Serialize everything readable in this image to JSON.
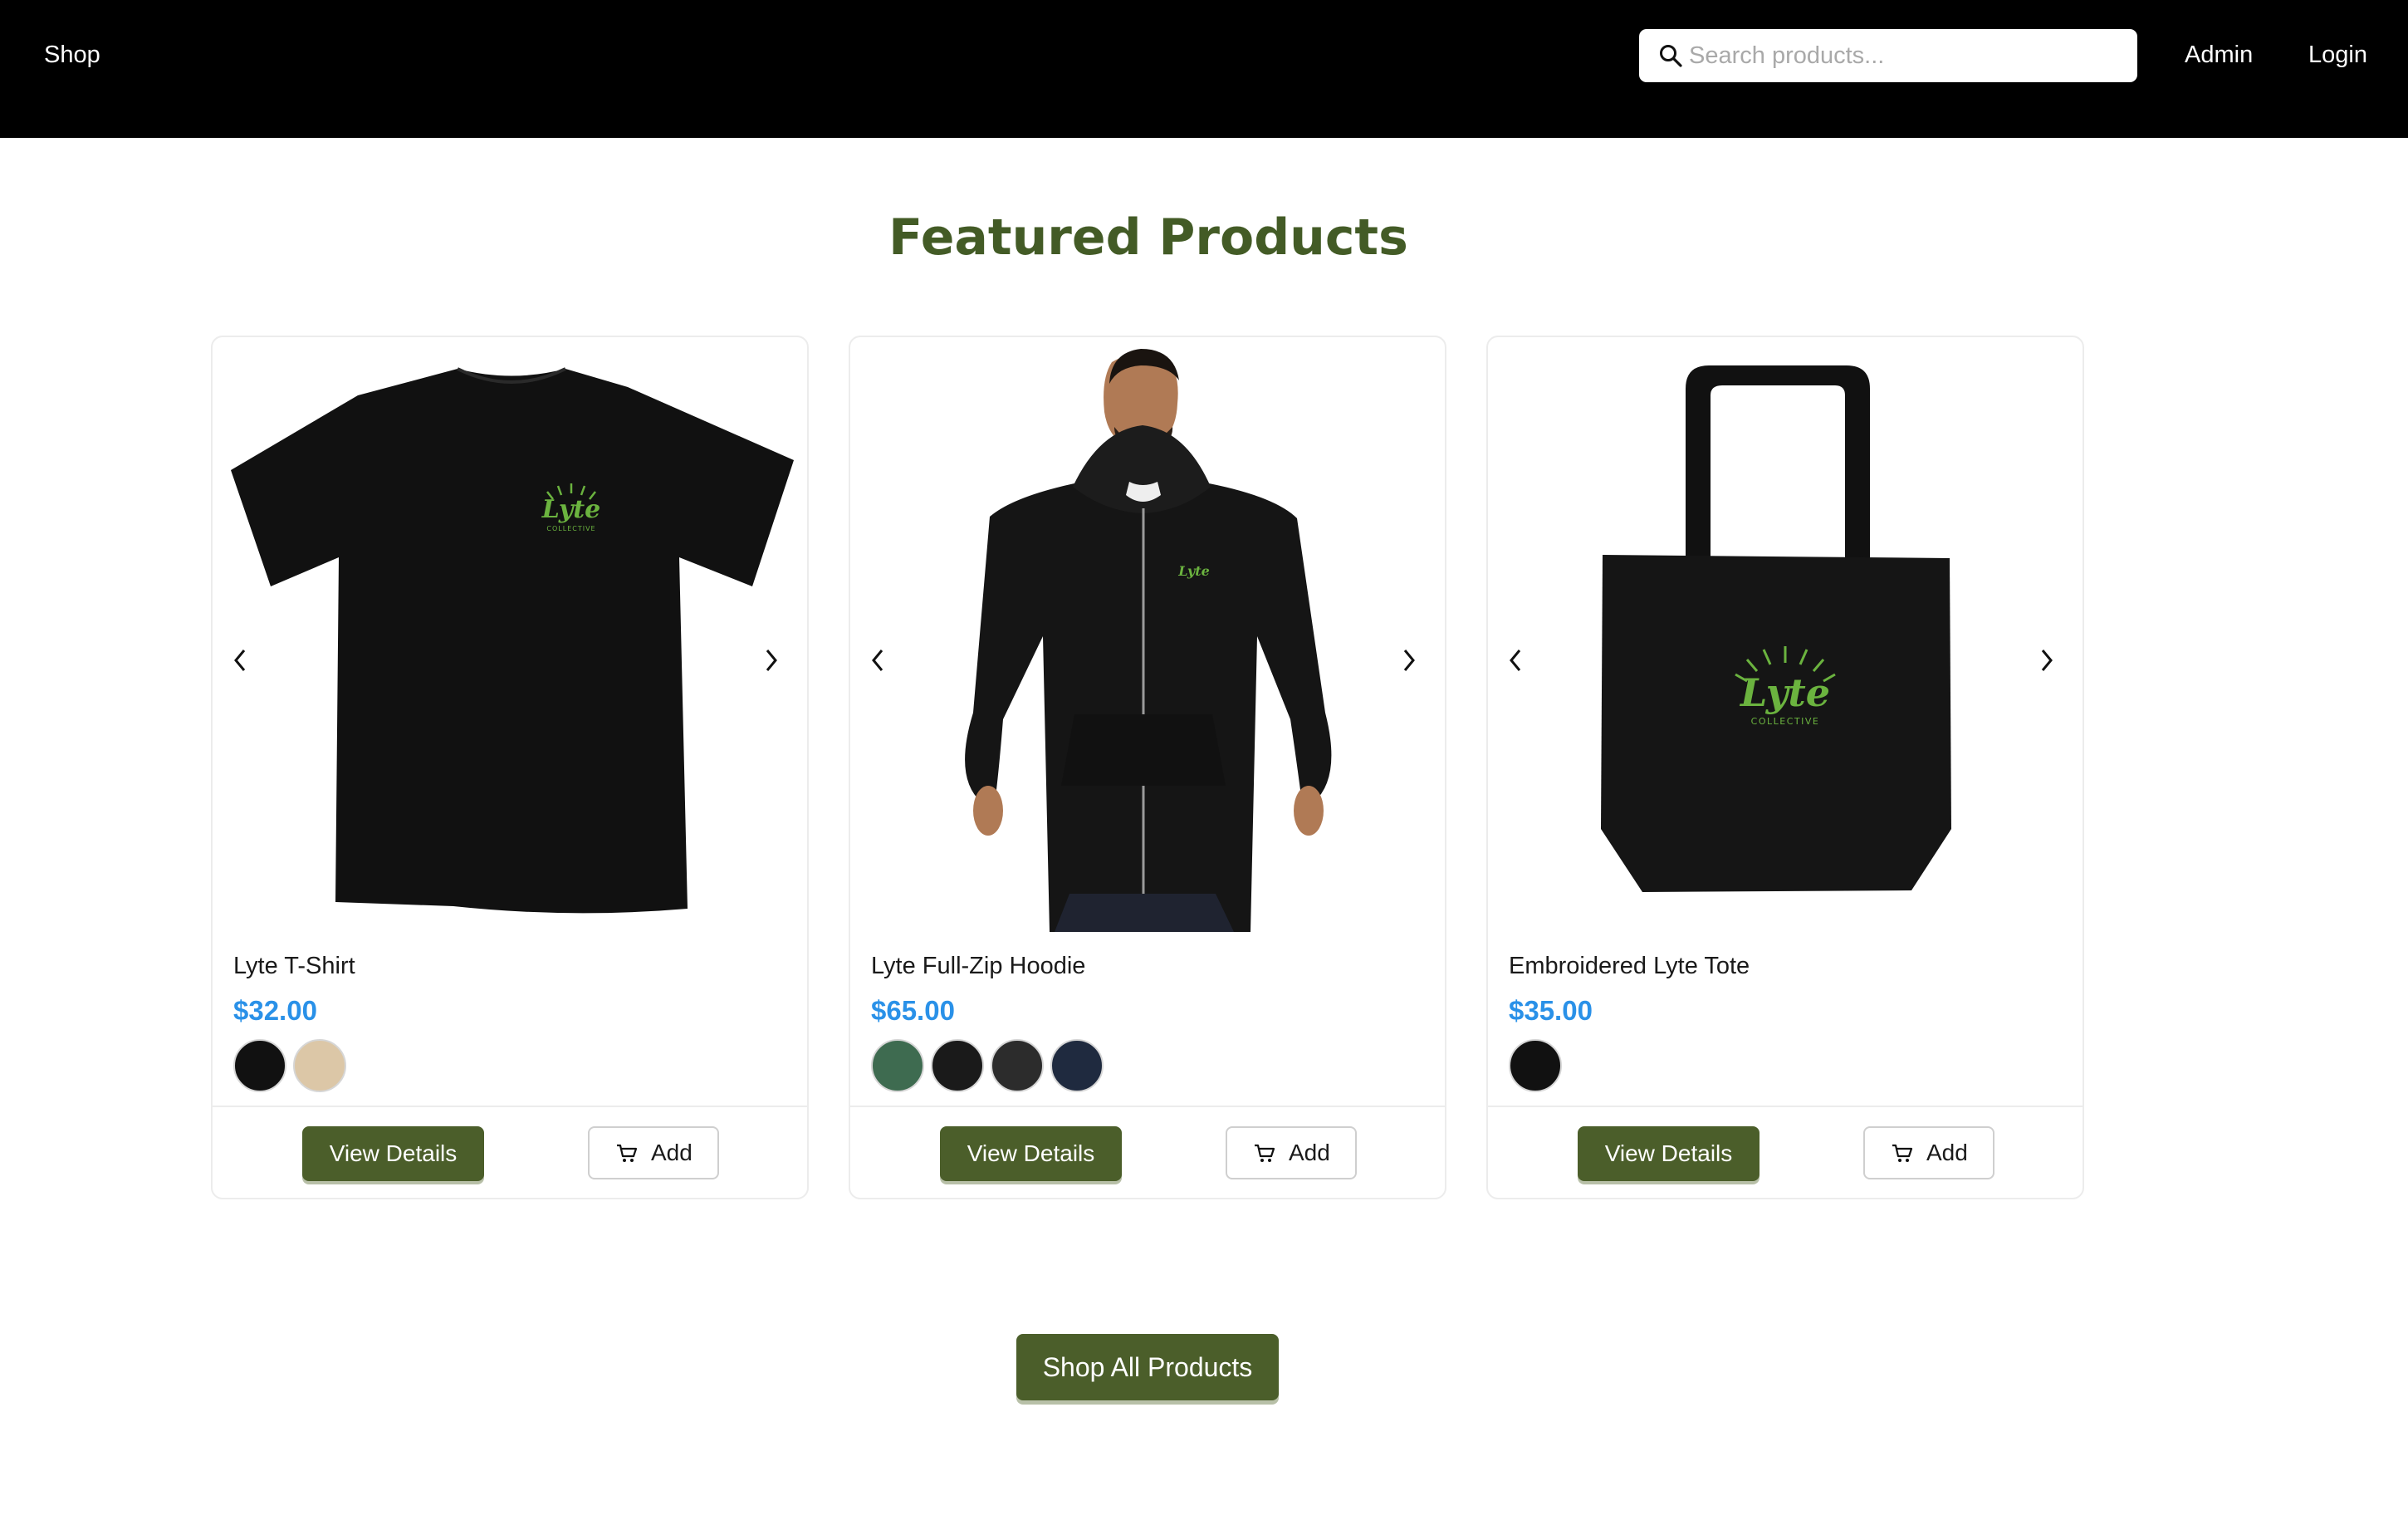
{
  "navbar": {
    "brand_label": "Shop",
    "search_placeholder": "Search products...",
    "search_value": "",
    "admin_label": "Admin",
    "login_label": "Login"
  },
  "page": {
    "title": "Featured Products",
    "shop_all_label": "Shop All Products"
  },
  "products": [
    {
      "name": "Lyte T-Shirt",
      "price": "$32.00",
      "swatches": [
        "#111111",
        "#dcc7a7"
      ],
      "view_label": "View Details",
      "add_label": "Add"
    },
    {
      "name": "Lyte Full-Zip Hoodie",
      "price": "$65.00",
      "swatches": [
        "#3e6b50",
        "#1a1a1a",
        "#2c2c2c",
        "#1f2a3f"
      ],
      "view_label": "View Details",
      "add_label": "Add"
    },
    {
      "name": "Embroidered Lyte Tote",
      "price": "$35.00",
      "swatches": [
        "#111111"
      ],
      "view_label": "View Details",
      "add_label": "Add"
    }
  ],
  "colors": {
    "accent_green": "#4b5e2a",
    "title_green": "#435b26",
    "price_blue": "#2a91e8",
    "logo_green": "#6bb33f"
  },
  "icons": {
    "search": "search-icon",
    "prev": "chevron-left-icon",
    "next": "chevron-right-icon",
    "cart": "cart-icon"
  }
}
